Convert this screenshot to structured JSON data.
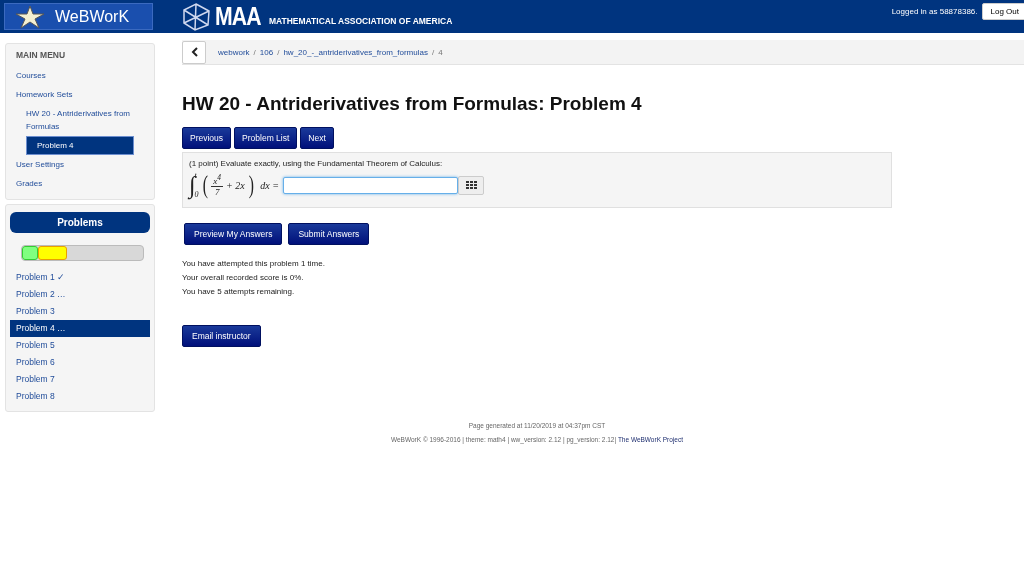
{
  "header": {
    "brand": "WeBWorK",
    "org_short": "MAA",
    "org_full": "MATHEMATICAL ASSOCIATION OF AMERICA",
    "login_text": "Logged in as 58878386.",
    "logout": "Log Out"
  },
  "breadcrumb": [
    {
      "kind": "link",
      "text": "webwork"
    },
    {
      "kind": "separator",
      "text": "/"
    },
    {
      "kind": "link",
      "text": "106"
    },
    {
      "kind": "separator",
      "text": "/"
    },
    {
      "kind": "link",
      "text": "hw_20_-_antriderivatives_from_formulas"
    },
    {
      "kind": "separator",
      "text": "/"
    },
    {
      "kind": "current",
      "text": "4"
    }
  ],
  "main_menu": {
    "title": "MAIN MENU",
    "items": [
      {
        "label": "Courses",
        "selected": false
      },
      {
        "label": "Homework Sets",
        "selected": false,
        "children": [
          {
            "label": "HW 20 - Antriderivatives from Formulas",
            "selected": false,
            "children": [
              {
                "label": "Problem 4",
                "selected": true
              }
            ]
          }
        ]
      },
      {
        "label": "User Settings",
        "selected": false
      },
      {
        "label": "Grades",
        "selected": false
      }
    ]
  },
  "problems": {
    "title": "Problems",
    "progress": [
      {
        "color": "#80ff80",
        "level": 0.13
      },
      {
        "color": "#ffff00",
        "level": 0.24
      }
    ],
    "items": [
      {
        "label": "Problem 1 ✓",
        "selected": false
      },
      {
        "label": "Problem 2 …",
        "selected": false
      },
      {
        "label": "Problem 3",
        "selected": false
      },
      {
        "label": "Problem 4 …",
        "selected": true
      },
      {
        "label": "Problem 5",
        "selected": false
      },
      {
        "label": "Problem 6",
        "selected": false
      },
      {
        "label": "Problem 7",
        "selected": false
      },
      {
        "label": "Problem 8",
        "selected": false
      }
    ]
  },
  "title": "HW 20 - Antriderivatives from Formulas: Problem 4",
  "nav_buttons": [
    "Previous",
    "Problem List",
    "Next"
  ],
  "problem": {
    "prompt": "(1 point) Evaluate exactly, using the Fundamental Theorem of Calculus:",
    "math": {
      "integral": "∫",
      "upper": "t",
      "lower": "0",
      "open": "(",
      "numerator": "x$^{4}$",
      "denominator": "7",
      "rest": "+ 2x",
      "close": ")",
      "tail": "dx ="
    }
  },
  "submit_buttons": [
    "Preview My Answers",
    "Submit Answers"
  ],
  "attempt_messages": [
    "You have attempted this problem 1 time.",
    "Your overall recorded score is 0%.",
    "You have 5 attempts remaining."
  ],
  "email_button": "Email instructor",
  "footer": {
    "generated": "Page generated at 11/20/2019 at 04:37pm CST",
    "credits": "WeBWorK © 1996-2016 | theme: math4 | ww_version: 2.12 | pg_version: 2.12|",
    "project": "The WeBWorK Project"
  }
}
